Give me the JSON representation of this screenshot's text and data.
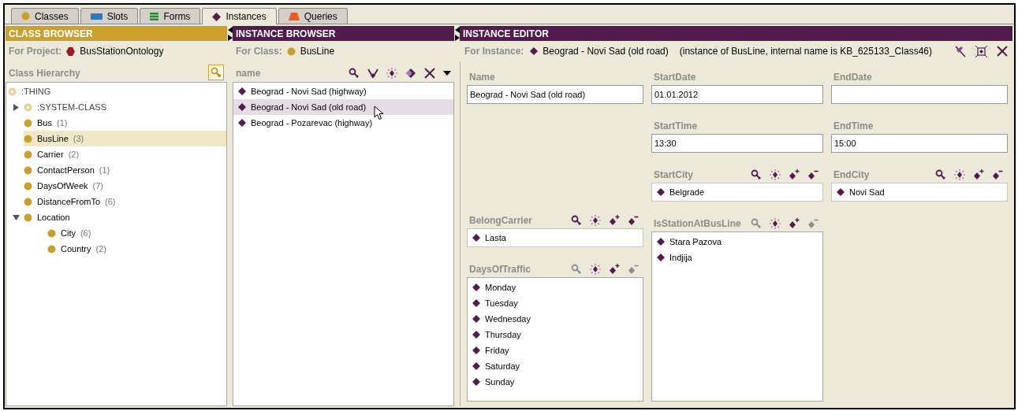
{
  "tabs": [
    {
      "label": "Classes",
      "kind": "class",
      "selected": false
    },
    {
      "label": "Slots",
      "kind": "slot",
      "selected": false
    },
    {
      "label": "Forms",
      "kind": "form",
      "selected": false
    },
    {
      "label": "Instances",
      "kind": "instance",
      "selected": true
    },
    {
      "label": "Queries",
      "kind": "query",
      "selected": false
    }
  ],
  "class_browser": {
    "title": "CLASS BROWSER",
    "project_label": "For Project:",
    "project": "BusStationOntology",
    "hierarchy_label": "Class Hierarchy",
    "tree": [
      {
        "label": ":THING",
        "kind": "system",
        "selected": false,
        "children": [
          {
            "label": ":SYSTEM-CLASS",
            "kind": "system",
            "selected": false,
            "expanded": false
          },
          {
            "label": "Bus",
            "count": "(1)",
            "kind": "class",
            "selected": false
          },
          {
            "label": "BusLine",
            "count": "(3)",
            "kind": "class",
            "selected": true
          },
          {
            "label": "Carrier",
            "count": "(2)",
            "kind": "class",
            "selected": false
          },
          {
            "label": "ContactPerson",
            "count": "(1)",
            "kind": "class",
            "selected": false
          },
          {
            "label": "DaysOfWeek",
            "count": "(7)",
            "kind": "class",
            "selected": false
          },
          {
            "label": "DistanceFromTo",
            "count": "(6)",
            "kind": "class",
            "selected": false
          },
          {
            "label": "Location",
            "kind": "class",
            "selected": false,
            "expanded": true,
            "children": [
              {
                "label": "City",
                "count": "(6)",
                "kind": "class",
                "selected": false
              },
              {
                "label": "Country",
                "count": "(2)",
                "kind": "class",
                "selected": false
              }
            ]
          }
        ]
      }
    ]
  },
  "instance_browser": {
    "title": "INSTANCE BROWSER",
    "class_label": "For Class:",
    "class": "BusLine",
    "column": "name",
    "instances": [
      {
        "name": "Beograd - Novi Sad (highway)",
        "selected": false
      },
      {
        "name": "Beograd - Novi Sad (old road)",
        "selected": true
      },
      {
        "name": "Beograd - Pozarevac (highway)",
        "selected": false
      }
    ]
  },
  "instance_editor": {
    "title": "INSTANCE EDITOR",
    "instance_label": "For Instance:",
    "instance": "Beograd - Novi Sad (old road)",
    "note": "(instance of BusLine, internal name is KB_625133_Class46)",
    "columns": [
      [
        {
          "label": "Name",
          "kind": "text",
          "value": "Beograd - Novi Sad (old road)"
        },
        {
          "label": "BelongCarrier",
          "kind": "instance",
          "items": [
            "Lasta"
          ],
          "actions": [
            {
              "kind": "find",
              "disabled": false
            },
            {
              "kind": "create",
              "disabled": false
            },
            {
              "kind": "add",
              "disabled": false
            },
            {
              "kind": "remove",
              "disabled": false
            }
          ]
        },
        {
          "label": "DaysOfTraffic",
          "kind": "instance_list",
          "items": [
            "Monday",
            "Tuesday",
            "Wednesday",
            "Thursday",
            "Friday",
            "Saturday",
            "Sunday"
          ],
          "actions": [
            {
              "kind": "find",
              "disabled": true
            },
            {
              "kind": "create",
              "disabled": false
            },
            {
              "kind": "add",
              "disabled": false
            },
            {
              "kind": "remove",
              "disabled": true
            }
          ]
        }
      ],
      [
        {
          "label": "StartDate",
          "kind": "text",
          "value": "01.01.2012"
        },
        {
          "label": "StartTime",
          "kind": "text",
          "value": "13:30"
        },
        {
          "label": "StartCity",
          "kind": "instance",
          "items": [
            "Belgrade"
          ],
          "actions": [
            {
              "kind": "find",
              "disabled": false
            },
            {
              "kind": "create",
              "disabled": false
            },
            {
              "kind": "add",
              "disabled": false
            },
            {
              "kind": "remove",
              "disabled": false
            }
          ]
        },
        {
          "label": "IsStationAtBusLine",
          "kind": "instance_list",
          "items": [
            "Stara Pazova",
            "Indjija"
          ],
          "actions": [
            {
              "kind": "find",
              "disabled": true
            },
            {
              "kind": "create",
              "disabled": false
            },
            {
              "kind": "add",
              "disabled": false
            },
            {
              "kind": "remove",
              "disabled": true
            }
          ]
        }
      ],
      [
        {
          "label": "EndDate",
          "kind": "text"
        },
        {
          "label": "EndTime",
          "kind": "text",
          "value": "15:00"
        },
        {
          "label": "EndCity",
          "kind": "instance",
          "items": [
            "Novi Sad"
          ],
          "actions": [
            {
              "kind": "find",
              "disabled": false
            },
            {
              "kind": "create",
              "disabled": false
            },
            {
              "kind": "add",
              "disabled": false
            },
            {
              "kind": "remove",
              "disabled": false
            }
          ]
        }
      ]
    ]
  }
}
